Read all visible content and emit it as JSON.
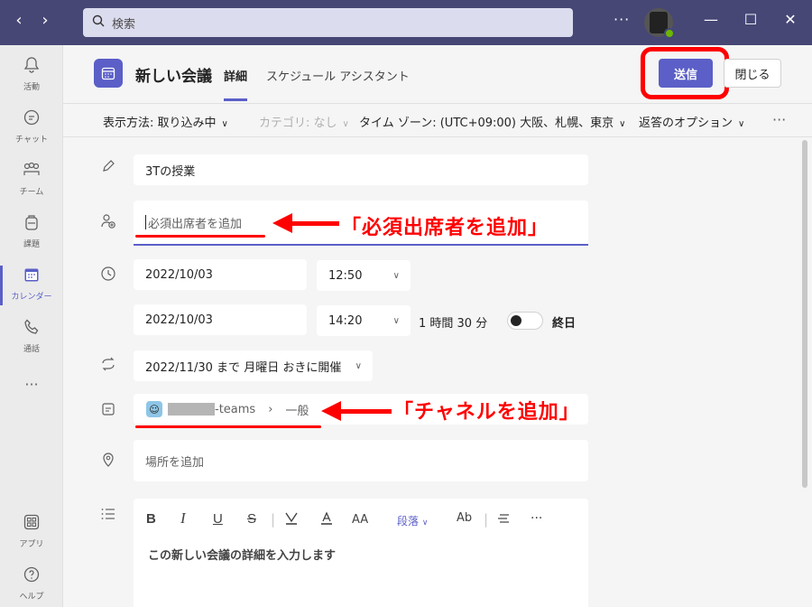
{
  "titlebar": {
    "search_placeholder": "検索",
    "more": "···"
  },
  "rail": {
    "items": [
      {
        "label": "活動",
        "icon": "bell-icon"
      },
      {
        "label": "チャット",
        "icon": "chat-icon"
      },
      {
        "label": "チーム",
        "icon": "teams-icon"
      },
      {
        "label": "課題",
        "icon": "backpack-icon"
      },
      {
        "label": "カレンダー",
        "icon": "calendar-icon"
      },
      {
        "label": "通話",
        "icon": "phone-icon"
      },
      {
        "label": "アプリ",
        "icon": "apps-icon"
      },
      {
        "label": "ヘルプ",
        "icon": "help-icon"
      }
    ],
    "more": "···"
  },
  "header": {
    "title": "新しい会議",
    "tabs": [
      {
        "label": "詳細"
      },
      {
        "label": "スケジュール アシスタント"
      }
    ],
    "send_label": "送信",
    "close_label": "閉じる"
  },
  "options": {
    "show_as": "表示方法: 取り込み中",
    "category": "カテゴリ: なし",
    "timezone": "タイム ゾーン: (UTC+09:00) 大阪、札幌、東京",
    "response": "返答のオプション",
    "more": "···"
  },
  "form": {
    "title": "3Tの授業",
    "attendee_placeholder": "必須出席者を追加",
    "start_date": "2022/10/03",
    "start_time": "12:50",
    "end_date": "2022/10/03",
    "end_time": "14:20",
    "duration": "1 時間 30 分",
    "all_day": "終日",
    "recurrence": "2022/11/30 まで 月曜日 おきに開催",
    "channel_team_suffix": "-teams",
    "channel_name": "一般",
    "location_placeholder": "場所を追加",
    "editor_paragraph": "段落",
    "editor_placeholder": "この新しい会議の詳細を入力します"
  },
  "annotations": {
    "attendee_callout": "「必須出席者を追加」",
    "channel_callout": "「チャネルを追加」"
  },
  "colors": {
    "titlebar": "#464775",
    "accent": "#5b5fc7",
    "highlight": "#ff0000"
  }
}
